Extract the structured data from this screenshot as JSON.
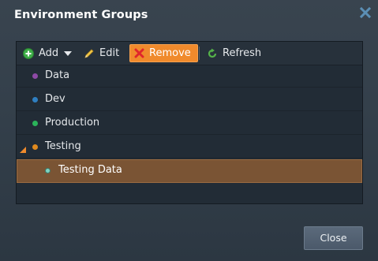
{
  "dialog": {
    "title": "Environment Groups",
    "close_label": "Close"
  },
  "toolbar": {
    "add_label": "Add",
    "edit_label": "Edit",
    "remove_label": "Remove",
    "refresh_label": "Refresh"
  },
  "groups": [
    {
      "label": "Data",
      "color": "#8e4aa6"
    },
    {
      "label": "Dev",
      "color": "#2f7fc1"
    },
    {
      "label": "Production",
      "color": "#2bb35a"
    },
    {
      "label": "Testing",
      "color": "#e08a1e",
      "expanded": true
    },
    {
      "label": "Testing Data",
      "color": "#7fd3c0",
      "child": true,
      "selected": true
    }
  ],
  "colors": {
    "accent": "#f08a2c",
    "selection": "#7a5434"
  }
}
